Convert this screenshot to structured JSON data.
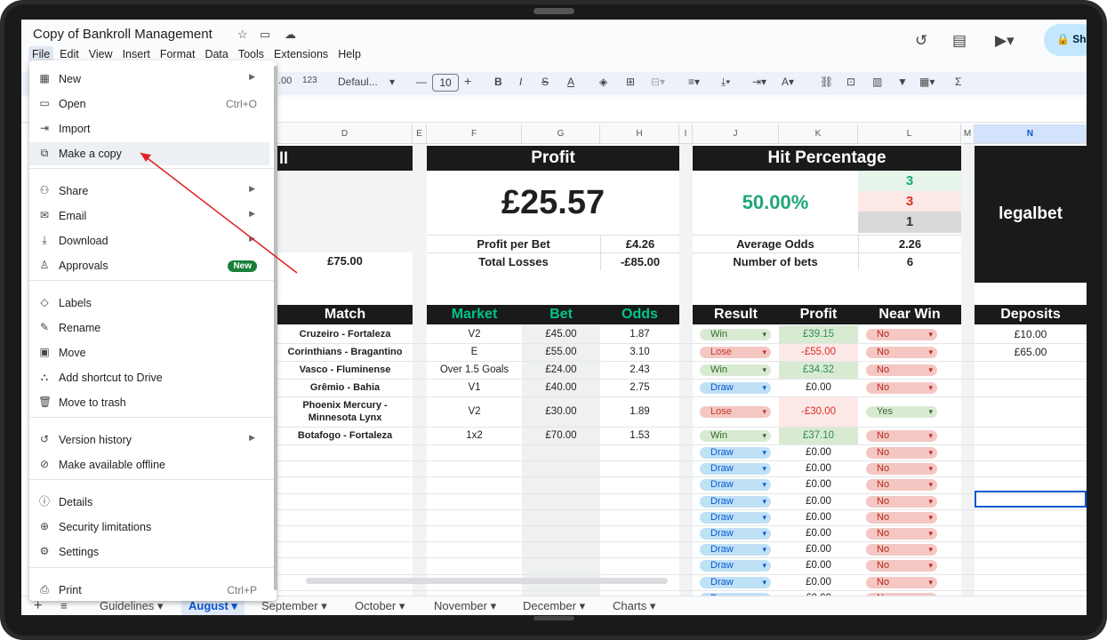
{
  "doc_title": "Copy of Bankroll Management",
  "menu": [
    "File",
    "Edit",
    "View",
    "Insert",
    "Format",
    "Data",
    "Tools",
    "Extensions",
    "Help"
  ],
  "share_label": "Sh",
  "toolbar": {
    "fmt": ".00",
    "num": "123",
    "font": "Defaul...",
    "size": "10"
  },
  "columns": [
    "D",
    "E",
    "F",
    "G",
    "H",
    "I",
    "J",
    "K",
    "L",
    "M",
    "N"
  ],
  "summary": {
    "d_header": "ll",
    "d_value": "£75.00",
    "profit_header": "Profit",
    "profit_big": "£25.57",
    "profit_per_bet_label": "Profit per Bet",
    "profit_per_bet_value": "£4.26",
    "total_losses_label": "Total Losses",
    "total_losses_value": "-£85.00",
    "hit_header": "Hit Percentage",
    "hit_percent": "50.00%",
    "wins": "3",
    "losses": "3",
    "draws": "1",
    "avg_odds_label": "Average Odds",
    "avg_odds_value": "2.26",
    "num_bets_label": "Number of bets",
    "num_bets_value": "6",
    "brand": "legalbet"
  },
  "table_headers": {
    "match": "Match",
    "market": "Market",
    "bet": "Bet",
    "odds": "Odds",
    "result": "Result",
    "profit": "Profit",
    "near_win": "Near Win",
    "deposits": "Deposits"
  },
  "bets": [
    {
      "match": "Cruzeiro - Fortaleza",
      "market": "V2",
      "bet": "£45.00",
      "odds": "1.87",
      "result": "Win",
      "profit": "£39.15",
      "near": "No"
    },
    {
      "match": "Corinthians - Bragantino",
      "market": "E",
      "bet": "£55.00",
      "odds": "3.10",
      "result": "Lose",
      "profit": "-£55.00",
      "near": "No"
    },
    {
      "match": "Vasco - Fluminense",
      "market": "Over 1.5 Goals",
      "bet": "£24.00",
      "odds": "2.43",
      "result": "Win",
      "profit": "£34.32",
      "near": "No"
    },
    {
      "match": "Grêmio - Bahia",
      "market": "V1",
      "bet": "£40.00",
      "odds": "2.75",
      "result": "Draw",
      "profit": "£0.00",
      "near": "No"
    },
    {
      "match": "Phoenix Mercury - Minnesota Lynx",
      "market": "V2",
      "bet": "£30.00",
      "odds": "1.89",
      "result": "Lose",
      "profit": "-£30.00",
      "near": "Yes"
    },
    {
      "match": "Botafogo - Fortaleza",
      "market": "1x2",
      "bet": "£70.00",
      "odds": "1.53",
      "result": "Win",
      "profit": "£37.10",
      "near": "No"
    }
  ],
  "empty_row": {
    "result": "Draw",
    "profit": "£0.00",
    "near": "No"
  },
  "deposits": [
    "£10.00",
    "£65.00"
  ],
  "file_menu": [
    {
      "icon": "new-icon",
      "glyph": "▦",
      "label": "New",
      "arrow": true
    },
    {
      "icon": "open-icon",
      "glyph": "▭",
      "label": "Open",
      "shortcut": "Ctrl+O"
    },
    {
      "icon": "import-icon",
      "glyph": "⇥",
      "label": "Import"
    },
    {
      "icon": "copy-icon",
      "glyph": "⧉",
      "label": "Make a copy"
    },
    {
      "icon": "share-icon",
      "glyph": "⚇",
      "label": "Share",
      "arrow": true
    },
    {
      "icon": "email-icon",
      "glyph": "✉",
      "label": "Email",
      "arrow": true
    },
    {
      "icon": "download-icon",
      "glyph": "⤓",
      "label": "Download",
      "arrow": true
    },
    {
      "icon": "approvals-icon",
      "glyph": "♙",
      "label": "Approvals",
      "badge": "New"
    },
    {
      "icon": "labels-icon",
      "glyph": "◇",
      "label": "Labels"
    },
    {
      "icon": "rename-icon",
      "glyph": "✎",
      "label": "Rename"
    },
    {
      "icon": "move-icon",
      "glyph": "▣",
      "label": "Move"
    },
    {
      "icon": "shortcut-icon",
      "glyph": "⛬",
      "label": "Add shortcut to Drive"
    },
    {
      "icon": "trash-icon",
      "glyph": "🗑",
      "label": "Move to trash"
    },
    {
      "icon": "history-icon",
      "glyph": "↺",
      "label": "Version history",
      "arrow": true
    },
    {
      "icon": "offline-icon",
      "glyph": "⊘",
      "label": "Make available offline"
    },
    {
      "icon": "details-icon",
      "glyph": "ⓘ",
      "label": "Details"
    },
    {
      "icon": "security-icon",
      "glyph": "⊕",
      "label": "Security limitations"
    },
    {
      "icon": "settings-icon",
      "glyph": "⚙",
      "label": "Settings"
    },
    {
      "icon": "print-icon",
      "glyph": "⎙",
      "label": "Print",
      "shortcut": "Ctrl+P"
    }
  ],
  "sheet_tabs": [
    "Guidelines",
    "August",
    "September",
    "October",
    "November",
    "December",
    "Charts"
  ],
  "active_tab": "August",
  "colors": {
    "accent_green": "#00c48c",
    "dark": "#1a1a1a",
    "pill_win": "#d9ead3",
    "pill_lose": "#f4c7c3",
    "pill_draw": "#bfe1f6",
    "arrow": "#e02020"
  }
}
